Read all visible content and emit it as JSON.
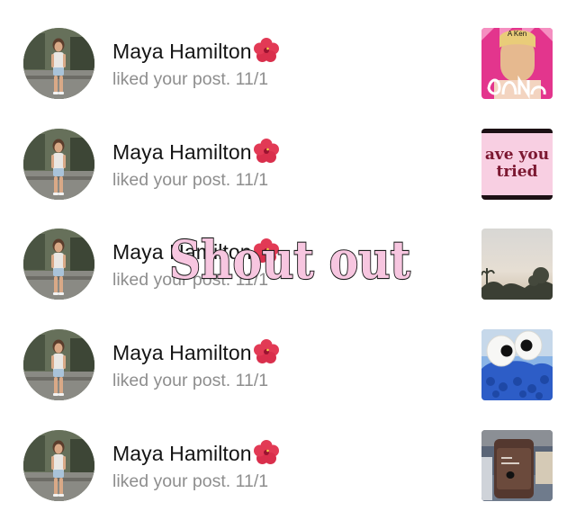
{
  "notifications": [
    {
      "user": "Maya Hamilton",
      "emoji": "hibiscus-emoji",
      "action": "liked your post.",
      "date": "11/1",
      "thumb_text": "A Ken"
    },
    {
      "user": "Maya Hamilton",
      "emoji": "hibiscus-emoji",
      "action": "liked your post.",
      "date": "11/1",
      "thumb_text": "ave you tried"
    },
    {
      "user": "Maya Hamilton",
      "emoji": "hibiscus-emoji",
      "action": "liked your post.",
      "date": "11/1",
      "thumb_text": ""
    },
    {
      "user": "Maya Hamilton",
      "emoji": "hibiscus-emoji",
      "action": "liked your post.",
      "date": "11/1",
      "thumb_text": ""
    },
    {
      "user": "Maya Hamilton",
      "emoji": "hibiscus-emoji",
      "action": "liked your post.",
      "date": "11/1",
      "thumb_text": ""
    }
  ],
  "overlay": {
    "text": "Shout out"
  },
  "colors": {
    "name": "#141414",
    "secondary": "#8e8e8e",
    "overlay_fill": "#f7c6e0",
    "overlay_stroke": "#1d1d1d"
  }
}
